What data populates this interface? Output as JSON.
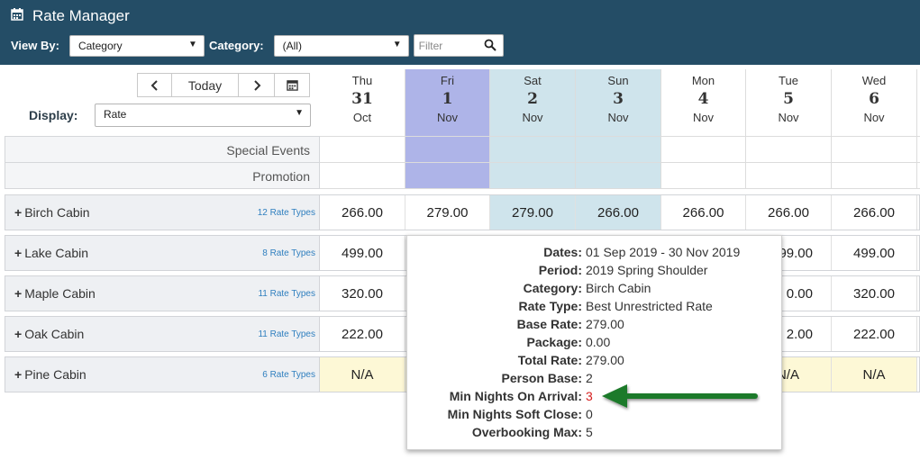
{
  "app": {
    "title": "Rate Manager",
    "title_icon": "calendar-icon"
  },
  "filters": {
    "view_by_label": "View By:",
    "view_by_value": "Category",
    "category_label": "Category:",
    "category_value": "(All)",
    "filter_placeholder": "Filter"
  },
  "nav": {
    "today_label": "Today",
    "prev_icon": "chevron-left-icon",
    "next_icon": "chevron-right-icon",
    "calendar_icon": "calendar-icon"
  },
  "display": {
    "label": "Display:",
    "value": "Rate"
  },
  "days": [
    {
      "name": "Thu",
      "num": "31",
      "month": "Oct",
      "style": "normal"
    },
    {
      "name": "Fri",
      "num": "1",
      "month": "Nov",
      "style": "selected"
    },
    {
      "name": "Sat",
      "num": "2",
      "month": "Nov",
      "style": "weekend"
    },
    {
      "name": "Sun",
      "num": "3",
      "month": "Nov",
      "style": "weekend"
    },
    {
      "name": "Mon",
      "num": "4",
      "month": "Nov",
      "style": "normal"
    },
    {
      "name": "Tue",
      "num": "5",
      "month": "Nov",
      "style": "normal"
    },
    {
      "name": "Wed",
      "num": "6",
      "month": "Nov",
      "style": "normal"
    }
  ],
  "info_rows": [
    "Special Events",
    "Promotion"
  ],
  "rooms": [
    {
      "name": "Birch Cabin",
      "rate_types": "12 Rate Types",
      "rates": [
        "266.00",
        "279.00",
        "279.00",
        "266.00",
        "266.00",
        "266.00",
        "266.00"
      ]
    },
    {
      "name": "Lake Cabin",
      "rate_types": "8 Rate Types",
      "rates": [
        "499.00",
        "",
        "",
        "",
        "",
        "",
        "499.00"
      ],
      "partial": {
        "5": "99.00"
      }
    },
    {
      "name": "Maple Cabin",
      "rate_types": "11 Rate Types",
      "rates": [
        "320.00",
        "",
        "",
        "",
        "",
        "",
        "320.00"
      ],
      "partial": {
        "5": "0.00"
      }
    },
    {
      "name": "Oak Cabin",
      "rate_types": "11 Rate Types",
      "rates": [
        "222.00",
        "",
        "",
        "",
        "",
        "",
        "222.00"
      ],
      "partial": {
        "5": "2.00"
      }
    },
    {
      "name": "Pine Cabin",
      "rate_types": "6 Rate Types",
      "rates": [
        "N/A",
        "",
        "",
        "",
        "",
        "",
        "N/A"
      ],
      "partial": {
        "5": "N/A"
      }
    }
  ],
  "tooltip": [
    {
      "label": "Dates:",
      "value": "01 Sep 2019 - 30 Nov 2019"
    },
    {
      "label": "Period:",
      "value": "2019 Spring Shoulder"
    },
    {
      "label": "Category:",
      "value": "Birch Cabin"
    },
    {
      "label": "Rate Type:",
      "value": "Best Unrestricted Rate"
    },
    {
      "label": "Base Rate:",
      "value": "279.00"
    },
    {
      "label": "Package:",
      "value": "0.00"
    },
    {
      "label": "Total Rate:",
      "value": "279.00"
    },
    {
      "label": "Person Base:",
      "value": "2"
    },
    {
      "label": "Min Nights On Arrival:",
      "value": "3",
      "highlight": true
    },
    {
      "label": "Min Nights Soft Close:",
      "value": "0"
    },
    {
      "label": "Overbooking Max:",
      "value": "5"
    }
  ],
  "colors": {
    "header": "#244d66",
    "selected_day": "#aeb4e8",
    "weekend": "#cfe4ec",
    "na_cell": "#fdf8d6",
    "arrow": "#1e7a2a",
    "highlight_value": "#d62020"
  }
}
